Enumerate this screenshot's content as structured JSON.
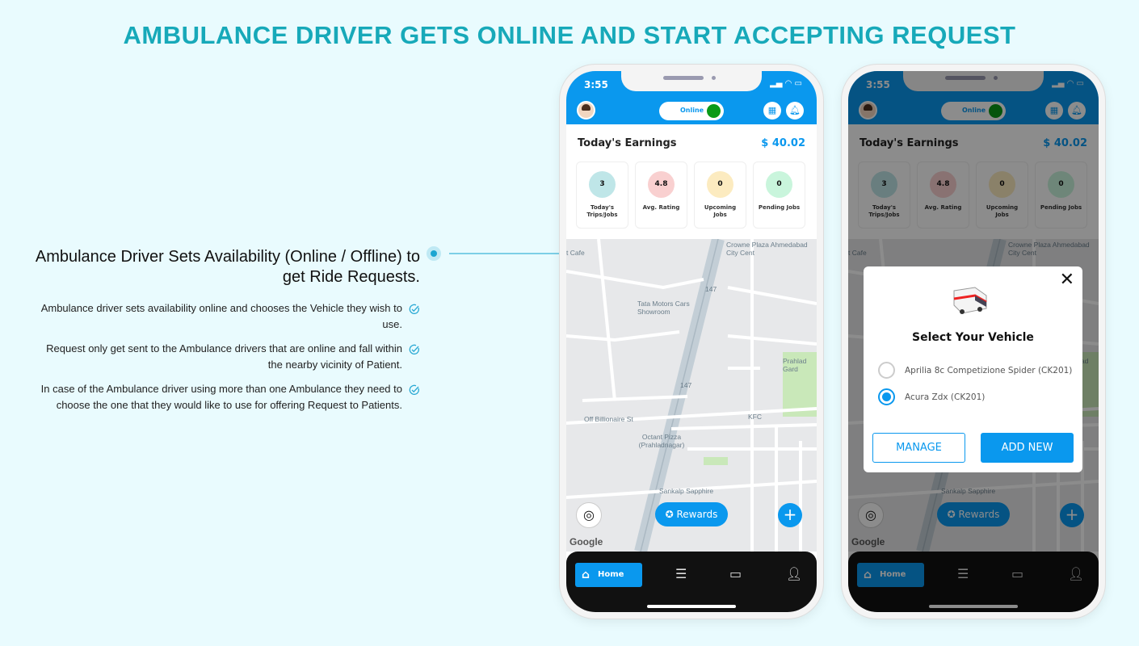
{
  "title": "AMBULANCE DRIVER GETS ONLINE AND START ACCEPTING REQUEST",
  "feature": {
    "heading": "Ambulance Driver Sets Availability (Online / Offline) to get Ride Requests.",
    "points": [
      "Ambulance driver sets availability online and chooses the Vehicle they wish to use.",
      "Request only get sent to the Ambulance drivers that are online and fall within the nearby vicinity of Patient.",
      "In case of the Ambulance driver using more than one Ambulance they need to choose the one that they would like to use for offering Request to Patients."
    ]
  },
  "phone": {
    "time": "3:55",
    "status_label": "Online",
    "earnings_label": "Today's Earnings",
    "earnings_amount": "$ 40.02",
    "stats": [
      {
        "value": "3",
        "label": "Today's Trips/Jobs",
        "color": "#bfe6e8"
      },
      {
        "value": "4.8",
        "label": "Avg. Rating",
        "color": "#f9d0d0"
      },
      {
        "value": "0",
        "label": "Upcoming Jobs",
        "color": "#fcebc0"
      },
      {
        "value": "0",
        "label": "Pending Jobs",
        "color": "#c9f5dc"
      }
    ],
    "map_labels": [
      "Crowne Plaza Ahmedabad City Cent",
      "t Cafe",
      "Tata Motors Cars Showroom",
      "147",
      "147",
      "Prahlad Gard",
      "Off Billionaire St",
      "KFC",
      "Octant Pizza (Prahladnagar)",
      "Sankalp Sapphire"
    ],
    "rewards_label": "Rewards",
    "google_label": "Google",
    "nav": {
      "home": "Home"
    }
  },
  "modal": {
    "title": "Select Your Vehicle",
    "options": [
      {
        "label": "Aprilia 8c Competizione Spider (CK201)",
        "selected": false
      },
      {
        "label": "Acura Zdx (CK201)",
        "selected": true
      }
    ],
    "manage_label": "MANAGE",
    "add_new_label": "ADD NEW"
  },
  "colors": {
    "accent": "#0a98ee",
    "title": "#17a9b9",
    "online": "#0a9a17"
  }
}
